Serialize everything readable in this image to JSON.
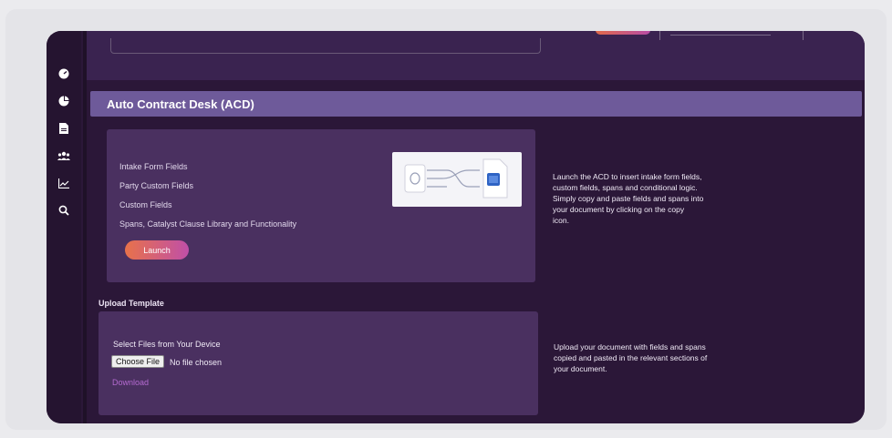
{
  "header": {
    "title": "Auto Contract Desk (ACD)"
  },
  "acd": {
    "items": [
      "Intake Form Fields",
      "Party Custom Fields",
      "Custom Fields",
      "Spans, Catalyst Clause Library and Functionality"
    ],
    "launch_label": "Launch",
    "description_lines": [
      "Launch the ACD to insert intake form fields,",
      "custom fields, spans and conditional logic.",
      "Simply copy and paste fields and spans into",
      "your document by clicking on the copy",
      "icon."
    ]
  },
  "upload": {
    "title": "Upload Template",
    "select_label": "Select Files from Your Device",
    "choose_label": "Choose File",
    "no_file_text": "No file chosen",
    "download_label": "Download",
    "description_lines": [
      "Upload your document with fields and spans",
      "copied and pasted in the relevant sections of",
      "your document."
    ]
  },
  "sidebar": {
    "icons": [
      "dashboard-icon",
      "pie-chart-icon",
      "document-icon",
      "users-icon",
      "line-chart-icon",
      "search-icon"
    ]
  },
  "colors": {
    "accent_start": "#e8724a",
    "accent_end": "#c04fa8",
    "header_band": "#6e5a9a",
    "panel": "#4a3060",
    "app_bg": "#2b1738"
  }
}
